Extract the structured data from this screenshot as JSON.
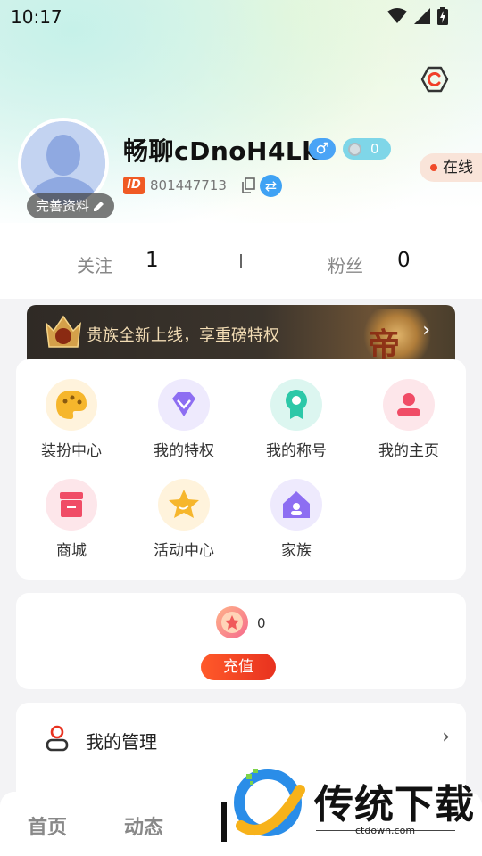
{
  "status_bar": {
    "time": "10:17",
    "icons": [
      "wifi-icon",
      "signal-icon",
      "battery-icon"
    ]
  },
  "profile": {
    "nickname": "畅聊cDnoH4Lk",
    "gender_symbol": "♂",
    "level_value": "0",
    "edit_label": "完善资料",
    "id_tag": "ID",
    "id_number": "801447713",
    "online_label": "在线"
  },
  "stats": {
    "following_label": "关注",
    "following_value": "1",
    "fans_label": "粉丝",
    "fans_value": "0"
  },
  "noble_banner": {
    "text": "贵族全新上线，享重磅特权",
    "emblem_char": "帝"
  },
  "features": [
    {
      "label": "装扮中心",
      "icon": "palette-icon",
      "color": "#fff3dc"
    },
    {
      "label": "我的特权",
      "icon": "diamond-icon",
      "color": "#eeeafd"
    },
    {
      "label": "我的称号",
      "icon": "medal-icon",
      "color": "#dcf6f0"
    },
    {
      "label": "我的主页",
      "icon": "user-home-icon",
      "color": "#fde6ea"
    },
    {
      "label": "商城",
      "icon": "shop-icon",
      "color": "#fde6ea"
    },
    {
      "label": "活动中心",
      "icon": "star-icon",
      "color": "#fff3dc"
    },
    {
      "label": "家族",
      "icon": "family-home-icon",
      "color": "#eeeafd"
    }
  ],
  "wallet": {
    "amount": "0",
    "recharge_label": "充值"
  },
  "manage": {
    "label": "我的管理"
  },
  "bottom_nav": {
    "home": "首页",
    "feed": "动态"
  },
  "watermark": {
    "text": "传统下载",
    "url": "ctdown.com"
  },
  "colors": {
    "accent": "#f05a24",
    "online_dot": "#f04a2a",
    "recharge": "#e8321f",
    "gender_badge": "#4aa4f6",
    "level_badge": "#7fd6e8"
  }
}
